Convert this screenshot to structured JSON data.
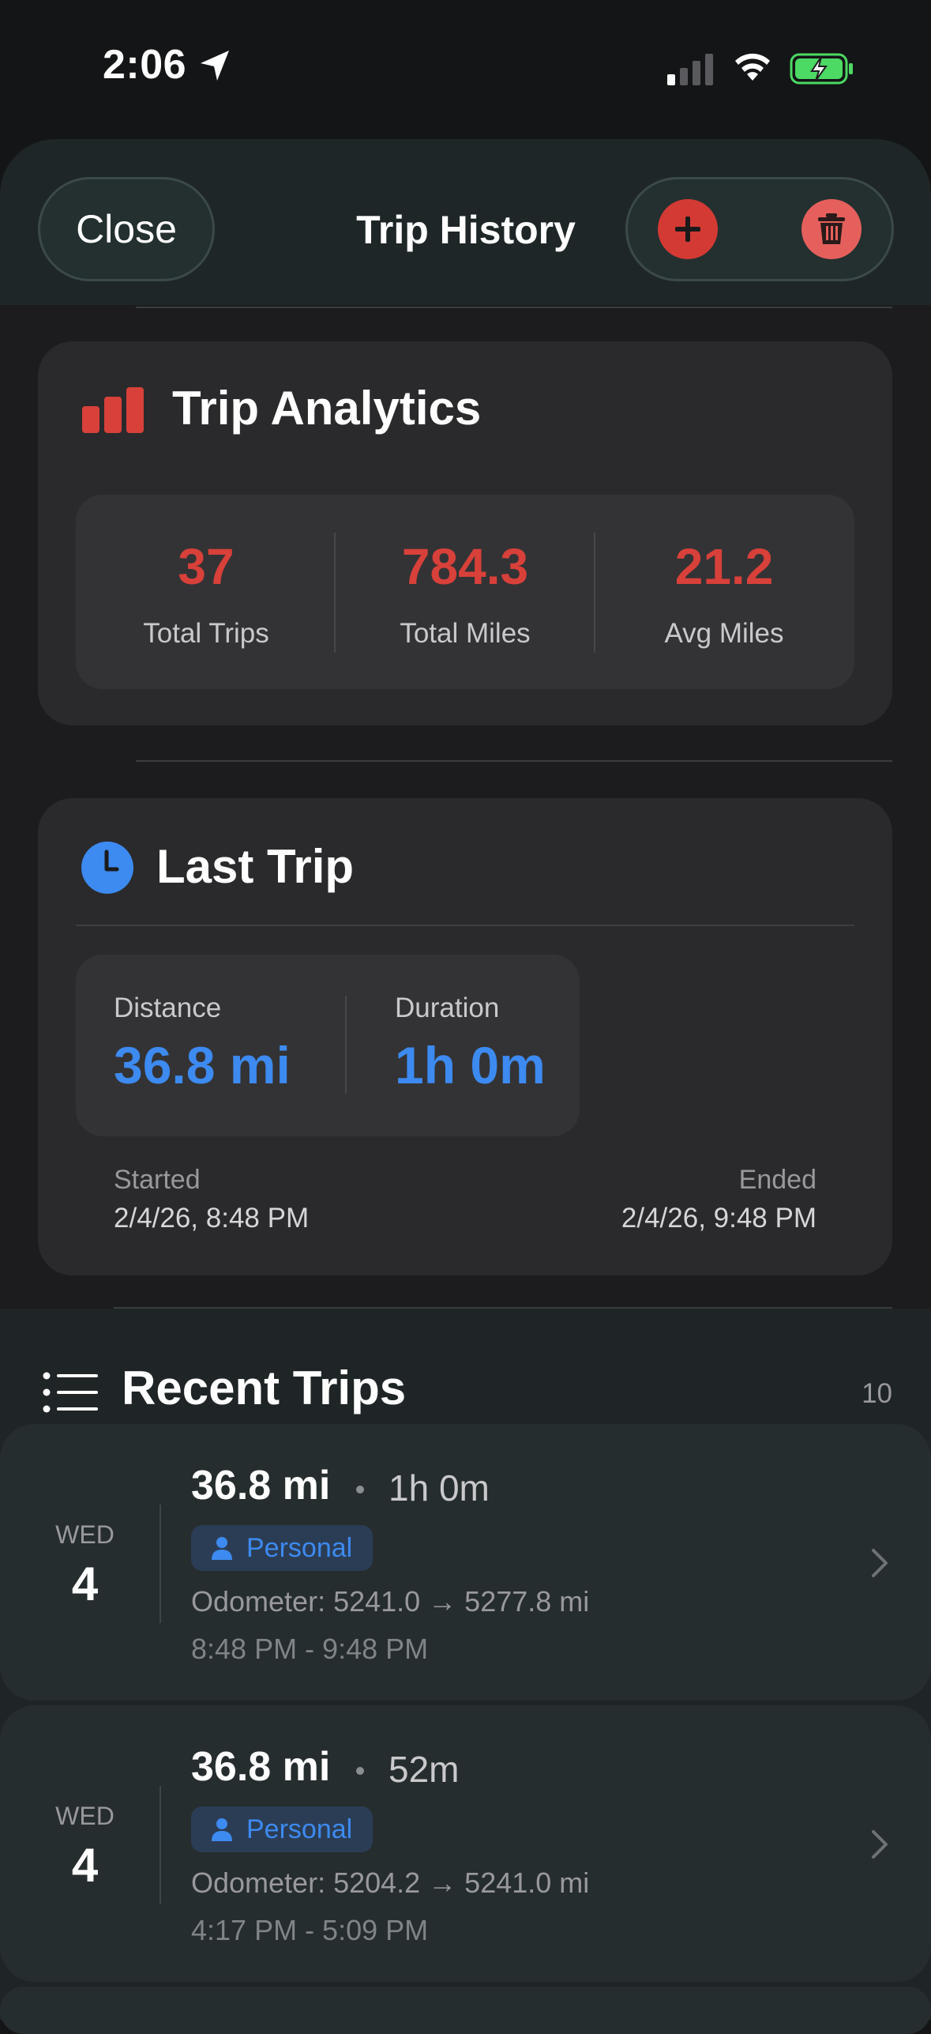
{
  "status_bar": {
    "time": "2:06",
    "icons": [
      "location-arrow-icon",
      "signal-icon",
      "wifi-icon",
      "battery-charging-icon"
    ]
  },
  "header": {
    "close_label": "Close",
    "title": "Trip History",
    "add_icon": "plus-icon",
    "delete_icon": "trash-icon"
  },
  "analytics": {
    "title": "Trip Analytics",
    "icon": "bar-chart-icon",
    "stats": [
      {
        "value": "37",
        "label": "Total Trips"
      },
      {
        "value": "784.3",
        "label": "Total Miles"
      },
      {
        "value": "21.2",
        "label": "Avg Miles"
      }
    ]
  },
  "last_trip": {
    "title": "Last Trip",
    "icon": "clock-icon",
    "distance_label": "Distance",
    "distance_value": "36.8 mi",
    "duration_label": "Duration",
    "duration_value": "1h 0m",
    "started_label": "Started",
    "started_value": "2/4/26, 8:48 PM",
    "ended_label": "Ended",
    "ended_value": "2/4/26, 9:48 PM"
  },
  "recent": {
    "title": "Recent Trips",
    "count": "10",
    "icon": "list-icon",
    "trips": [
      {
        "day": "WED",
        "date": "4",
        "miles": "36.8 mi",
        "duration": "1h 0m",
        "category": "Personal",
        "odometer": "Odometer: 5241.0 → 5277.8 mi",
        "time_range": "8:48 PM - 9:48 PM"
      },
      {
        "day": "WED",
        "date": "4",
        "miles": "36.8 mi",
        "duration": "52m",
        "category": "Personal",
        "odometer": "Odometer: 5204.2 → 5241.0 mi",
        "time_range": "4:17 PM - 5:09 PM"
      }
    ]
  },
  "colors": {
    "accent_red": "#d8403a",
    "accent_blue": "#3d8af0",
    "trash_red": "#e5605c",
    "battery_green": "#4cd964"
  }
}
